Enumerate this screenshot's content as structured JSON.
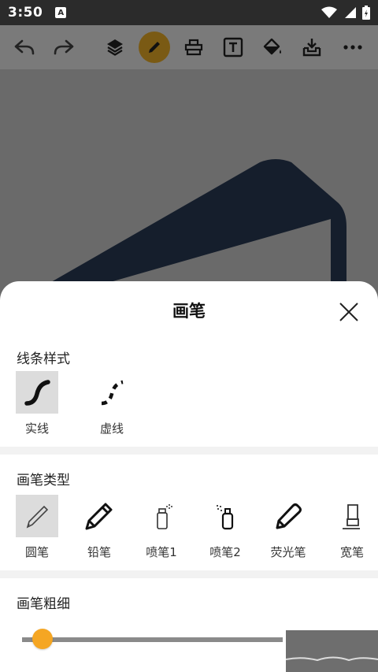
{
  "status_bar": {
    "time": "3:50",
    "notification_icon": "A"
  },
  "toolbar": {
    "active_tool": "brush",
    "active_color": "#7a5a14",
    "icons": [
      "undo-icon",
      "redo-icon",
      "layers-icon",
      "brush-icon",
      "eraser-icon",
      "text-icon",
      "fill-bucket-icon",
      "save-download-icon",
      "more-icon"
    ]
  },
  "sheet": {
    "title": "画笔",
    "line_style": {
      "title": "线条样式",
      "options": [
        {
          "label": "实线",
          "selected": true
        },
        {
          "label": "虚线",
          "selected": false
        }
      ]
    },
    "brush_type": {
      "title": "画笔类型",
      "options": [
        {
          "label": "圆笔",
          "selected": true
        },
        {
          "label": "铅笔",
          "selected": false
        },
        {
          "label": "喷笔1",
          "selected": false
        },
        {
          "label": "喷笔2",
          "selected": false
        },
        {
          "label": "荧光笔",
          "selected": false
        },
        {
          "label": "宽笔",
          "selected": false
        }
      ]
    },
    "thickness": {
      "title": "画笔粗细",
      "value": 0.04,
      "accent": "#f5a623"
    }
  }
}
